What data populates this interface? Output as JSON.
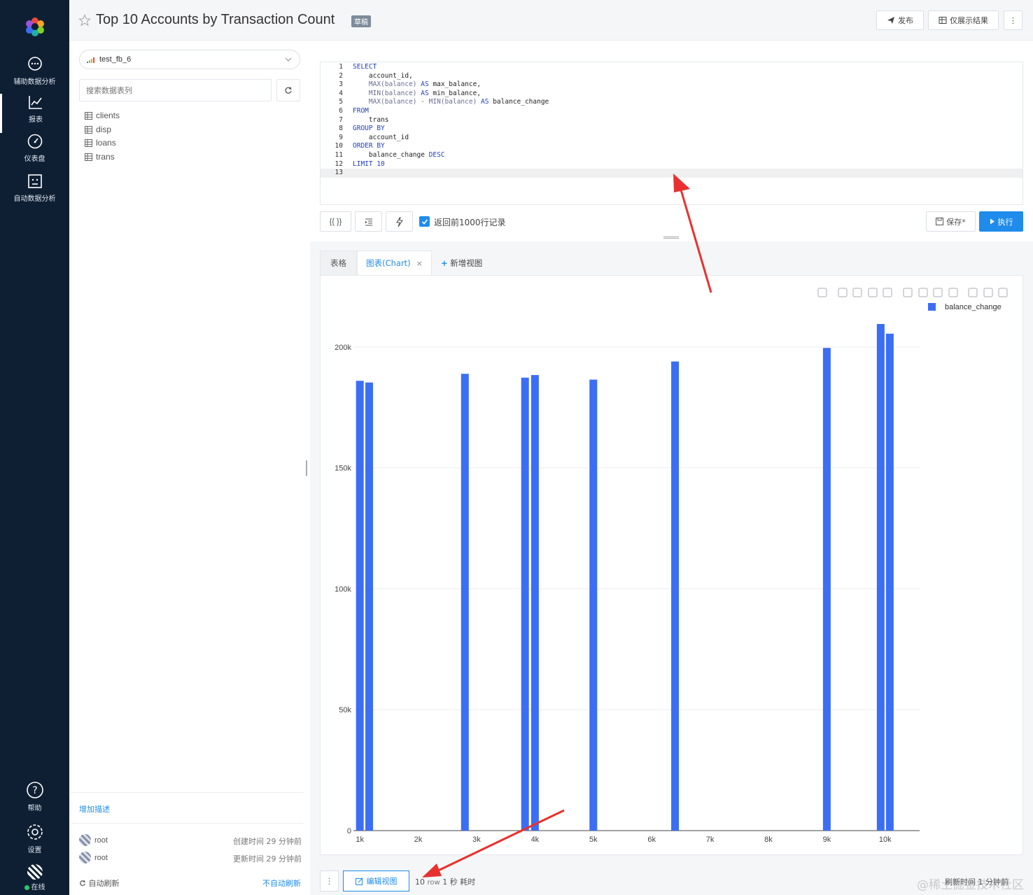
{
  "nav": {
    "items": [
      {
        "label": "辅助数据分析",
        "icon": "chat-icon"
      },
      {
        "label": "报表",
        "icon": "line-chart-icon"
      },
      {
        "label": "仪表盘",
        "icon": "gauge-icon"
      },
      {
        "label": "自动数据分析",
        "icon": "robot-icon"
      }
    ],
    "help": "帮助",
    "settings": "设置",
    "status": "在线"
  },
  "header": {
    "title": "Top 10 Accounts by Transaction Count",
    "draft_badge": "草稿",
    "publish_label": "发布",
    "show_results_label": "仅展示结果",
    "more_label": "⋮"
  },
  "sidebar": {
    "datasource": "test_fb_6",
    "search_placeholder": "搜索数据表列",
    "tables": [
      "clients",
      "disp",
      "loans",
      "trans"
    ],
    "add_description": "增加描述",
    "created_by": "root",
    "created_time": "创建时间 29 分钟前",
    "updated_by": "root",
    "updated_time": "更新时间 29 分钟前",
    "auto_refresh": "自动刷新",
    "no_auto_refresh": "不自动刷新"
  },
  "editor": {
    "lines": [
      {
        "n": "1",
        "code": [
          {
            "t": "SELECT",
            "c": "kw"
          }
        ]
      },
      {
        "n": "2",
        "code": [
          {
            "t": "    account_id,",
            "c": ""
          }
        ]
      },
      {
        "n": "3",
        "code": [
          {
            "t": "    MAX(balance) ",
            "c": "fn"
          },
          {
            "t": "AS",
            "c": "kw"
          },
          {
            "t": " max_balance,",
            "c": ""
          }
        ]
      },
      {
        "n": "4",
        "code": [
          {
            "t": "    MIN(balance) ",
            "c": "fn"
          },
          {
            "t": "AS",
            "c": "kw"
          },
          {
            "t": " min_balance,",
            "c": ""
          }
        ]
      },
      {
        "n": "5",
        "code": [
          {
            "t": "    MAX(balance) - MIN(balance) ",
            "c": "fn"
          },
          {
            "t": "AS",
            "c": "kw"
          },
          {
            "t": " balance_change",
            "c": ""
          }
        ]
      },
      {
        "n": "6",
        "code": [
          {
            "t": "FROM",
            "c": "kw"
          }
        ]
      },
      {
        "n": "7",
        "code": [
          {
            "t": "    trans",
            "c": ""
          }
        ]
      },
      {
        "n": "8",
        "code": [
          {
            "t": "GROUP BY",
            "c": "kw"
          }
        ]
      },
      {
        "n": "9",
        "code": [
          {
            "t": "    account_id",
            "c": ""
          }
        ]
      },
      {
        "n": "10",
        "code": [
          {
            "t": "ORDER BY",
            "c": "kw"
          }
        ]
      },
      {
        "n": "11",
        "code": [
          {
            "t": "    balance_change ",
            "c": ""
          },
          {
            "t": "DESC",
            "c": "kw"
          }
        ]
      },
      {
        "n": "12",
        "code": [
          {
            "t": "LIMIT 10",
            "c": "kw"
          }
        ]
      },
      {
        "n": "13",
        "code": []
      }
    ],
    "format_label": "{{ }}",
    "limit_checkbox_label": "返回前1000行记录",
    "save_label": "保存*",
    "run_label": "执行"
  },
  "tabs": {
    "table_label": "表格",
    "chart_label": "图表(Chart)",
    "add_view_label": "新增视图"
  },
  "chart_data": {
    "type": "bar",
    "series": [
      {
        "name": "balance_change",
        "x": [
          9923,
          10079,
          9000,
          6400,
          2800,
          4000,
          3830,
          5000,
          1000,
          1160
        ],
        "values": [
          209500,
          205500,
          199600,
          194000,
          188900,
          188400,
          187300,
          186500,
          186000,
          185300
        ]
      }
    ],
    "x_ticks": [
      "1k",
      "2k",
      "3k",
      "4k",
      "5k",
      "6k",
      "7k",
      "8k",
      "9k",
      "10k"
    ],
    "y_ticks": [
      "0",
      "50k",
      "100k",
      "150k",
      "200k"
    ],
    "color": "#3b6ef5",
    "legend": "top-right",
    "grid": true,
    "xlim": [
      890,
      10590
    ],
    "ylim": [
      0,
      209500
    ]
  },
  "bottom": {
    "edit_view_label": "编辑视图",
    "rows": "10",
    "row_unit": "row",
    "duration": "1 秒 耗时",
    "refresh_time": "刷新时间 1 分钟前",
    "watermark": "@稀土掘金技术社区"
  }
}
